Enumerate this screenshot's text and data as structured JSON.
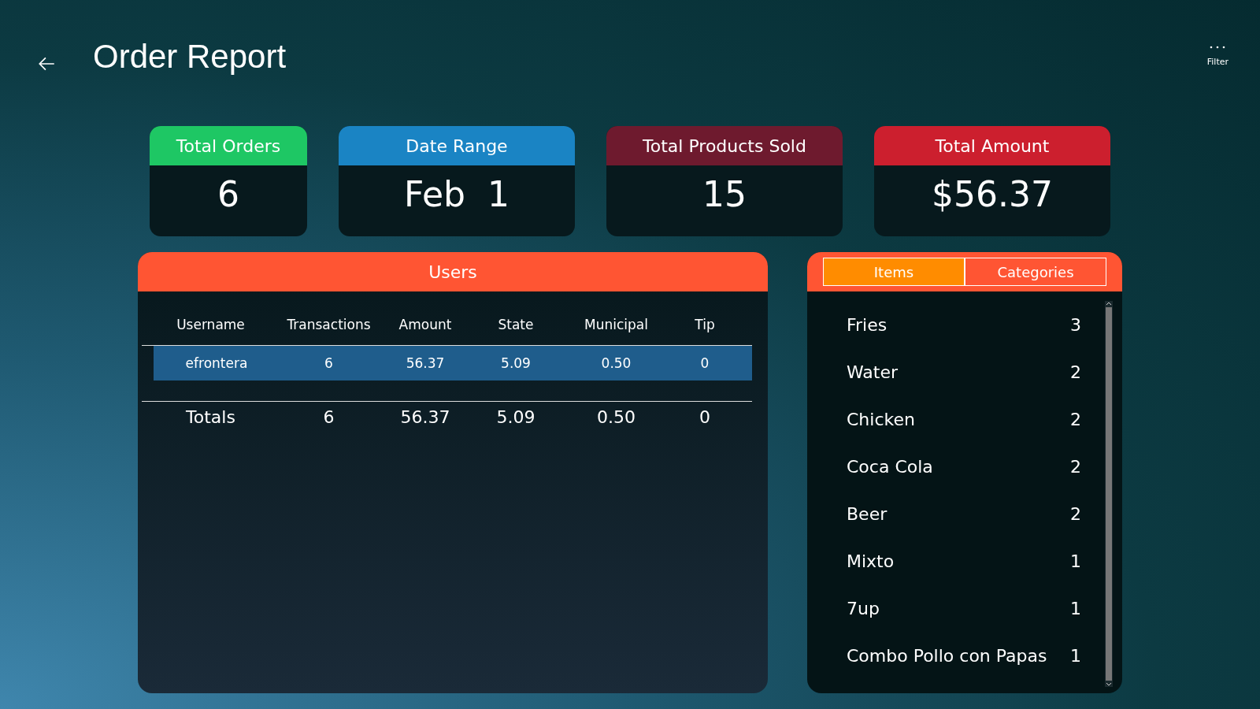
{
  "header": {
    "title": "Order Report",
    "filter_label": "Filter"
  },
  "stats": [
    {
      "label": "Total Orders",
      "value": "6",
      "color": "#1ec764"
    },
    {
      "label": "Date Range",
      "value": "Feb  1",
      "color": "#1a84c4"
    },
    {
      "label": "Total Products Sold",
      "value": "15",
      "color": "#6e1a2e"
    },
    {
      "label": "Total Amount",
      "value": "$56.37",
      "color": "#cc1f2e"
    }
  ],
  "users": {
    "title": "Users",
    "columns": [
      "Username",
      "Transactions",
      "Amount",
      "State",
      "Municipal",
      "Tip"
    ],
    "rows": [
      {
        "cells": [
          "efrontera",
          "6",
          "56.37",
          "5.09",
          "0.50",
          "0"
        ],
        "selected": true
      }
    ],
    "totals": [
      "Totals",
      "6",
      "56.37",
      "5.09",
      "0.50",
      "0"
    ]
  },
  "products": {
    "tabs": [
      {
        "label": "Items",
        "selected": true
      },
      {
        "label": "Categories",
        "selected": false
      }
    ],
    "items": [
      {
        "name": "Fries",
        "count": "3"
      },
      {
        "name": "Water",
        "count": "2"
      },
      {
        "name": "Chicken",
        "count": "2"
      },
      {
        "name": "Coca Cola",
        "count": "2"
      },
      {
        "name": "Beer",
        "count": "2"
      },
      {
        "name": "Mixto",
        "count": "1"
      },
      {
        "name": "7up",
        "count": "1"
      },
      {
        "name": "Combo Pollo con Papas",
        "count": "1"
      }
    ]
  }
}
